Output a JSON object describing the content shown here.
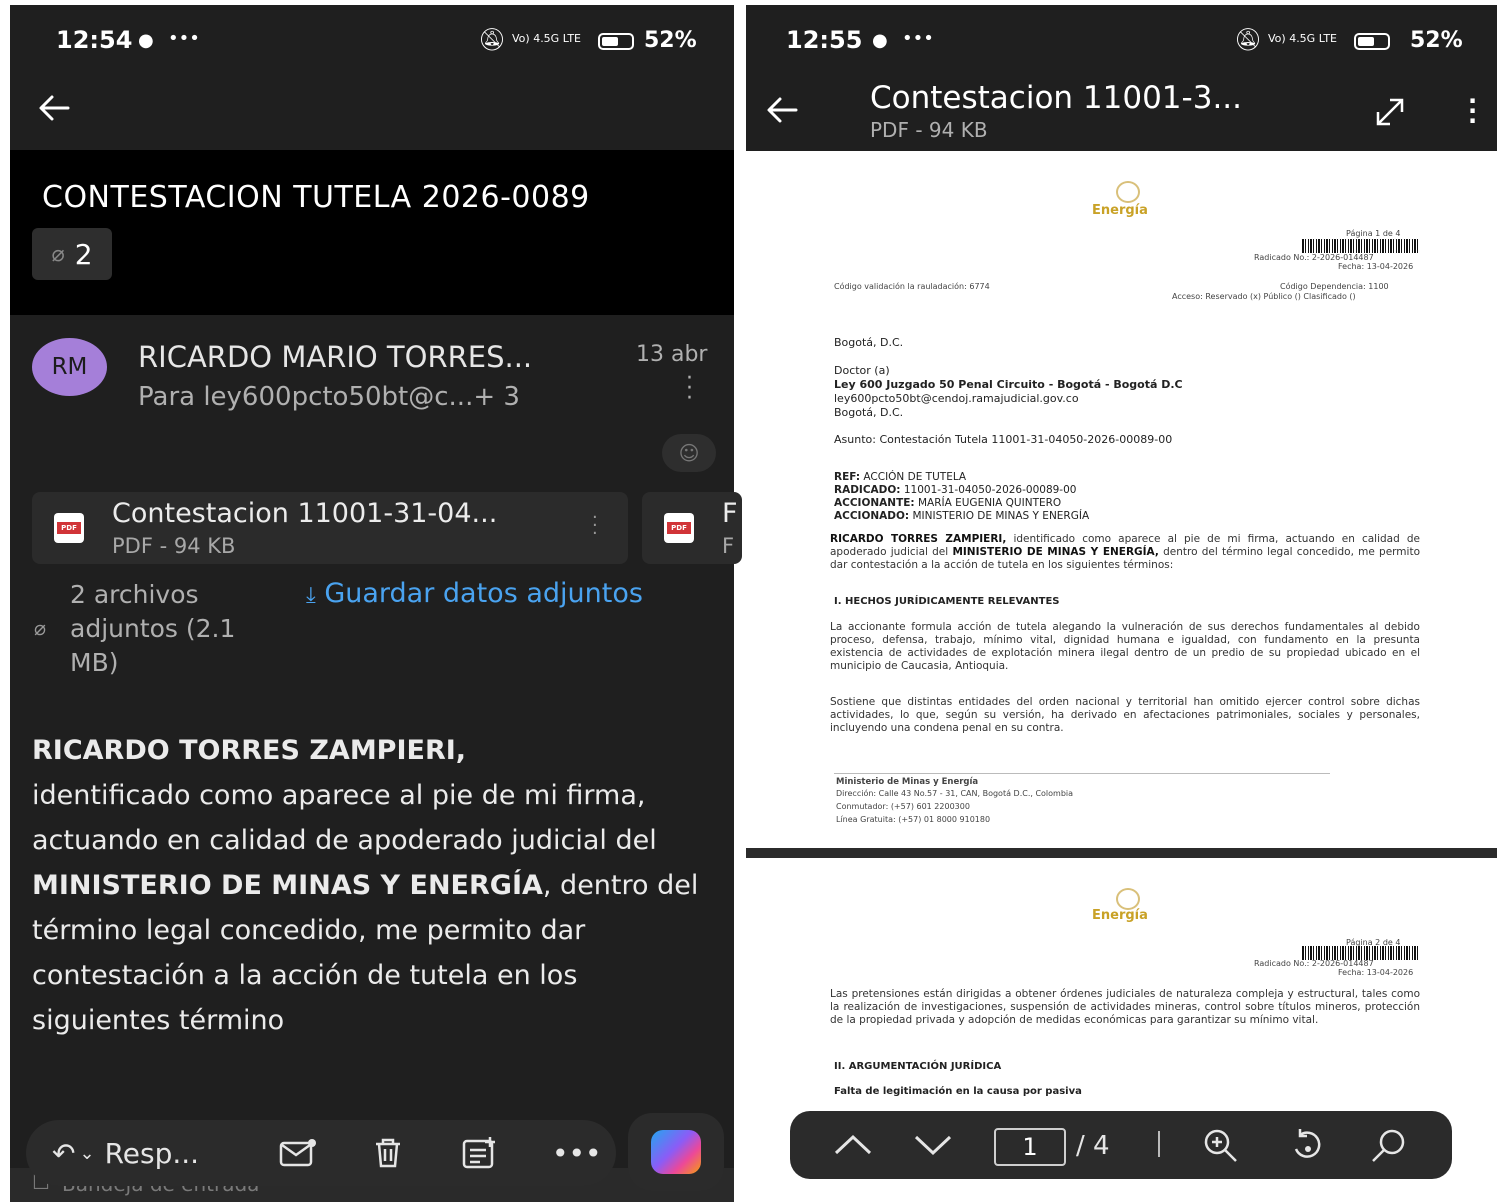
{
  "left": {
    "status": {
      "time": "12:54",
      "extra": "•••",
      "network": "Vo) 4.5G LTE",
      "battery": "52%"
    },
    "subject": "CONTESTACION TUTELA 2026-0089",
    "attachment_count": "2",
    "sender": {
      "initials": "RM",
      "name": "RICARDO MARIO TORRES...",
      "to": "Para ley600pcto50bt@c...+ 3",
      "date": "13 abr"
    },
    "attachments": [
      {
        "name": "Contestacion 11001-31-04...",
        "size": "PDF - 94 KB"
      },
      {
        "name": "F",
        "size": "F"
      }
    ],
    "attachments_summary": {
      "line1": "2 archivos",
      "line2": "adjuntos (2.1",
      "line3": "MB)"
    },
    "save_attachments": "Guardar datos adjuntos",
    "body": {
      "name": "RICARDO TORRES ZAMPIERI,",
      "t1": "identificado como aparece al pie de mi firma, actuando en calidad de apoderado judicial del",
      "ministry": "MINISTERIO DE MINAS Y ENERGÍA",
      "t2": ", dentro del término legal concedido, me permito dar contestación a la acción de tutela en los siguientes término"
    },
    "toolbar": {
      "reply": "Resp...",
      "more": "•••"
    },
    "folder": "Bandeja de entrada"
  },
  "right": {
    "status": {
      "time": "12:55",
      "extra": "•••",
      "network": "Vo) 4.5G LTE",
      "battery": "52%"
    },
    "title": "Contestacion 11001-3...",
    "subtitle": "PDF - 94 KB",
    "page1": {
      "logo": "Energía",
      "page_ref": "Página 1 de 4",
      "radicado": "Radicado No.: 2-2026-014487",
      "fecha": "Fecha: 13-04-2026",
      "codigo_validacion": "Código validación la rauladación: 6774",
      "codigo_dep": "Código Dependencia: 1100",
      "acceso": "Acceso: Reservado (x) Público () Clasificado ()",
      "city1": "Bogotá, D.C.",
      "doctor": "Doctor (a)",
      "court": "Ley 600 Juzgado 50 Penal Circuito - Bogotá - Bogotá D.C",
      "email": "ley600pcto50bt@cendoj.ramajudicial.gov.co",
      "city2": "Bogotá, D.C.",
      "asunto": "Asunto: Contestación Tutela 11001-31-04050-2026-00089-00",
      "ref_label": "REF:",
      "ref_value": "ACCIÓN DE TUTELA",
      "rad_label": "RADICADO:",
      "rad_value": "11001-31-04050-2026-00089-00",
      "accionante_label": "ACCIONANTE:",
      "accionante_value": "MARÍA EUGENIA QUINTERO",
      "accionado_label": "ACCIONADO:",
      "accionado_value": "MINISTERIO DE MINAS Y ENERGÍA",
      "p1_name": "RICARDO TORRES ZAMPIERI,",
      "p1_a": "identificado como aparece al pie de mi firma, actuando en calidad de apoderado judicial del",
      "p1_ministry": "MINISTERIO DE MINAS Y ENERGÍA,",
      "p1_b": "dentro del término legal concedido, me permito dar contestación a la acción de tutela en los siguientes términos:",
      "section1": "I. HECHOS JURÍDICAMENTE RELEVANTES",
      "p2": "La accionante formula acción de tutela alegando la vulneración de sus derechos fundamentales al debido proceso, defensa, trabajo, mínimo vital, dignidad humana e igualdad, con fundamento en la presunta existencia de actividades de explotación minera ilegal dentro de un predio de su propiedad ubicado en el municipio de Caucasia, Antioquia.",
      "p3": "Sostiene que distintas entidades del orden nacional y territorial han omitido ejercer control sobre dichas actividades, lo que, según su versión, ha derivado en afectaciones patrimoniales, sociales y personales, incluyendo una condena penal en su contra.",
      "footer_org": "Ministerio de Minas y Energía",
      "footer_addr": "Dirección: Calle 43 No.57 - 31, CAN, Bogotá D.C., Colombia",
      "footer_phone": "Conmutador: (+57) 601 2200300",
      "footer_free": "Línea Gratuita: (+57) 01 8000 910180"
    },
    "page2": {
      "logo": "Energía",
      "page_ref": "Página 2 de 4",
      "radicado": "Radicado No.: 2-2026-014487",
      "fecha": "Fecha: 13-04-2026",
      "p1": "Las pretensiones están dirigidas a obtener órdenes judiciales de naturaleza compleja y estructural, tales como la realización de investigaciones, suspensión de actividades mineras, control sobre títulos mineros, protección de la propiedad privada y adopción de medidas económicas para garantizar su mínimo vital.",
      "section2": "II. ARGUMENTACIÓN JURÍDICA",
      "subsection": "Falta de legitimación en la causa por pasiva"
    },
    "nav": {
      "page": "1",
      "total": "/ 4"
    }
  }
}
